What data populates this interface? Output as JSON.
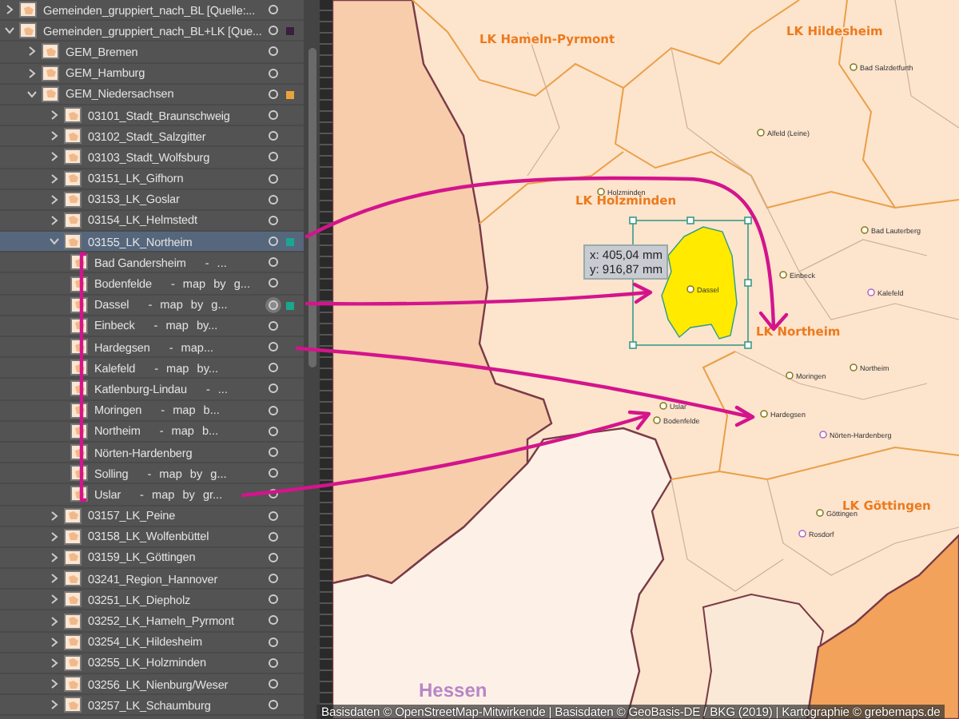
{
  "layers_panel": {
    "layers": [
      {
        "kind": "layer",
        "name": "Gemeinden_gruppiert_nach_BL [Quelle:...",
        "expanded": false,
        "selected": false,
        "targeted": false
      },
      {
        "kind": "layer",
        "name": "Gemeinden_gruppiert_nach_BL+LK [Que...",
        "expanded": true,
        "selected": false,
        "targeted": false,
        "color": "#3a1f3f",
        "children": [
          {
            "kind": "layer",
            "name": "GEM_Bremen",
            "expanded": false,
            "selected": false,
            "targeted": false
          },
          {
            "kind": "layer",
            "name": "GEM_Hamburg",
            "expanded": false,
            "selected": false,
            "targeted": false
          },
          {
            "kind": "layer",
            "name": "GEM_Niedersachsen",
            "expanded": true,
            "selected": false,
            "targeted": false,
            "color": "#e8a33a",
            "children": [
              {
                "kind": "layer",
                "name": "03101_Stadt_Braunschweig",
                "expanded": false,
                "selected": false,
                "targeted": false
              },
              {
                "kind": "layer",
                "name": "03102_Stadt_Salzgitter",
                "expanded": false,
                "selected": false,
                "targeted": false
              },
              {
                "kind": "layer",
                "name": "03103_Stadt_Wolfsburg",
                "expanded": false,
                "selected": false,
                "targeted": false
              },
              {
                "kind": "layer",
                "name": "03151_LK_Gifhorn",
                "expanded": false,
                "selected": false,
                "targeted": false
              },
              {
                "kind": "layer",
                "name": "03153_LK_Goslar",
                "expanded": false,
                "selected": false,
                "targeted": false
              },
              {
                "kind": "layer",
                "name": "03154_LK_Helmstedt",
                "expanded": false,
                "selected": false,
                "targeted": false
              },
              {
                "kind": "layer",
                "name": "03155_LK_Northeim",
                "expanded": true,
                "selected": true,
                "targeted": false,
                "color": "#1aa78e",
                "children": [
                  {
                    "kind": "object",
                    "name": "Bad Gandersheim",
                    "note": "- ...",
                    "selected": false,
                    "targeted": false
                  },
                  {
                    "kind": "object",
                    "name": "Bodenfelde",
                    "note": "- map by g...",
                    "selected": false,
                    "targeted": false
                  },
                  {
                    "kind": "object",
                    "name": "Dassel",
                    "note": "- map by g...",
                    "selected": false,
                    "targeted": true,
                    "color": "#1aa78e"
                  },
                  {
                    "kind": "object",
                    "name": "Einbeck",
                    "note": "- map by...",
                    "selected": false,
                    "targeted": false
                  },
                  {
                    "kind": "object",
                    "name": "Hardegsen",
                    "note": "- map...",
                    "selected": false,
                    "targeted": false
                  },
                  {
                    "kind": "object",
                    "name": "Kalefeld",
                    "note": "- map by...",
                    "selected": false,
                    "targeted": false
                  },
                  {
                    "kind": "object",
                    "name": "Katlenburg-Lindau",
                    "note": "- ...",
                    "selected": false,
                    "targeted": false
                  },
                  {
                    "kind": "object",
                    "name": "Moringen",
                    "note": "- map b...",
                    "selected": false,
                    "targeted": false
                  },
                  {
                    "kind": "object",
                    "name": "Northeim",
                    "note": "- map b...",
                    "selected": false,
                    "targeted": false
                  },
                  {
                    "kind": "object",
                    "name": "Nörten-Hardenberg",
                    "selected": false,
                    "targeted": false
                  },
                  {
                    "kind": "object",
                    "name": "Solling",
                    "note": "- map by g...",
                    "selected": false,
                    "targeted": false
                  },
                  {
                    "kind": "object",
                    "name": "Uslar",
                    "note": "- map by gr...",
                    "selected": false,
                    "targeted": false
                  }
                ]
              },
              {
                "kind": "layer",
                "name": "03157_LK_Peine",
                "expanded": false,
                "selected": false,
                "targeted": false
              },
              {
                "kind": "layer",
                "name": "03158_LK_Wolfenbüttel",
                "expanded": false,
                "selected": false,
                "targeted": false
              },
              {
                "kind": "layer",
                "name": "03159_LK_Göttingen",
                "expanded": false,
                "selected": false,
                "targeted": false
              },
              {
                "kind": "layer",
                "name": "03241_Region_Hannover",
                "expanded": false,
                "selected": false,
                "targeted": false
              },
              {
                "kind": "layer",
                "name": "03251_LK_Diepholz",
                "expanded": false,
                "selected": false,
                "targeted": false
              },
              {
                "kind": "layer",
                "name": "03252_LK_Hameln_Pyrmont",
                "expanded": false,
                "selected": false,
                "targeted": false
              },
              {
                "kind": "layer",
                "name": "03254_LK_Hildesheim",
                "expanded": false,
                "selected": false,
                "targeted": false
              },
              {
                "kind": "layer",
                "name": "03255_LK_Holzminden",
                "expanded": false,
                "selected": false,
                "targeted": false
              },
              {
                "kind": "layer",
                "name": "03256_LK_Nienburg/Weser",
                "expanded": false,
                "selected": false,
                "targeted": false
              },
              {
                "kind": "layer",
                "name": "03257_LK_Schaumburg",
                "expanded": false,
                "selected": false,
                "targeted": false
              }
            ]
          }
        ]
      }
    ]
  },
  "map": {
    "region_labels": [
      {
        "text": "LK Hameln-Pyrmont"
      },
      {
        "text": "LK Hildesheim"
      },
      {
        "text": "LK Holzminden"
      },
      {
        "text": "LK Northeim"
      },
      {
        "text": "LK Göttingen"
      }
    ],
    "state_label": "Hessen",
    "towns": [
      {
        "name": "Bad Salzdetfurth",
        "kind": "town"
      },
      {
        "name": "Alfeld (Leine)",
        "kind": "town"
      },
      {
        "name": "Holzminden",
        "kind": "town"
      },
      {
        "name": "Bad Lauterberg",
        "kind": "town"
      },
      {
        "name": "Einbeck",
        "kind": "town"
      },
      {
        "name": "Dassel",
        "kind": "town"
      },
      {
        "name": "Kalefeld",
        "kind": "village"
      },
      {
        "name": "Northeim",
        "kind": "town"
      },
      {
        "name": "Moringen",
        "kind": "town"
      },
      {
        "name": "Uslar",
        "kind": "town"
      },
      {
        "name": "Hardegsen",
        "kind": "town"
      },
      {
        "name": "Bodenfelde",
        "kind": "town"
      },
      {
        "name": "Nörten-Hardenberg",
        "kind": "village"
      },
      {
        "name": "Göttingen",
        "kind": "town"
      },
      {
        "name": "Rosdorf",
        "kind": "village"
      }
    ],
    "selection_readout": [
      "x: 405,04 mm",
      "y: 916,87 mm"
    ]
  },
  "credit": "Basisdaten © OpenStreetMap-Mitwirkende | Basisdaten © GeoBasis-DE / BKG (2019) | Kartographie © grebemaps.de"
}
